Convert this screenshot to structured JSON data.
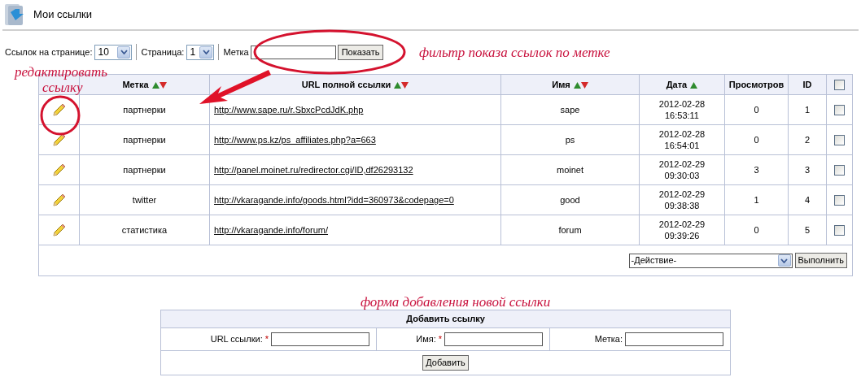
{
  "page": {
    "title": "Мои ссылки"
  },
  "toolbar": {
    "per_page_label": "Ссылок на странице:",
    "per_page_value": "10",
    "page_label": "Страница:",
    "page_value": "1",
    "tag_label": "Метка",
    "show_button": "Показать"
  },
  "annotations": [
    {
      "kind": "filter",
      "text": "фильтр показа ссылок по метке"
    },
    {
      "kind": "edit_line1",
      "text": "редактировать"
    },
    {
      "kind": "edit_line2",
      "text": "ссылку"
    },
    {
      "kind": "form",
      "text": "форма добавления новой ссылки"
    }
  ],
  "table": {
    "columns": [
      {
        "kind": "blank"
      },
      {
        "label": "Метка",
        "kind": "sortable"
      },
      {
        "label": "URL полной ссылки",
        "kind": "sortable"
      },
      {
        "label": "Имя",
        "kind": "sortable"
      },
      {
        "label": "Дата",
        "kind": "ascending"
      },
      {
        "label": "Просмотров",
        "kind": "plain"
      },
      {
        "label": "ID",
        "kind": "plain"
      },
      {
        "kind": "checkbox",
        "checked": false
      }
    ],
    "rows": [
      {
        "tag": "партнерки",
        "url": "http://www.sape.ru/r.SbxcPcdJdK.php",
        "name": "sape",
        "date": "2012-02-28",
        "time": "16:53:11",
        "views": "0",
        "id": "1",
        "checked": false
      },
      {
        "tag": "партнерки",
        "url": "http://www.ps.kz/ps_affiliates.php?a=663",
        "name": "ps",
        "date": "2012-02-28",
        "time": "16:54:01",
        "views": "0",
        "id": "2",
        "checked": false
      },
      {
        "tag": "партнерки",
        "url": "http://panel.moinet.ru/redirector.cgi/ID,df26293132",
        "name": "moinet",
        "date": "2012-02-29",
        "time": "09:30:03",
        "views": "3",
        "id": "3",
        "checked": false
      },
      {
        "tag": "twitter",
        "url": "http://vkaragande.info/goods.html?idd=360973&codepage=0",
        "name": "good",
        "date": "2012-02-29",
        "time": "09:38:38",
        "views": "1",
        "id": "4",
        "checked": false
      },
      {
        "tag": "статистика",
        "url": "http://vkaragande.info/forum/",
        "name": "forum",
        "date": "2012-02-29",
        "time": "09:39:26",
        "views": "0",
        "id": "5",
        "checked": false
      }
    ],
    "action_select": "-Действие-",
    "run_button": "Выполнить"
  },
  "add_form": {
    "title": "Добавить ссылку",
    "fields": [
      {
        "label": "URL ссылки:",
        "required_mark": "*"
      },
      {
        "label": "Имя:",
        "required_mark": "*"
      },
      {
        "label": "Метка:"
      }
    ],
    "submit": "Добавить"
  }
}
